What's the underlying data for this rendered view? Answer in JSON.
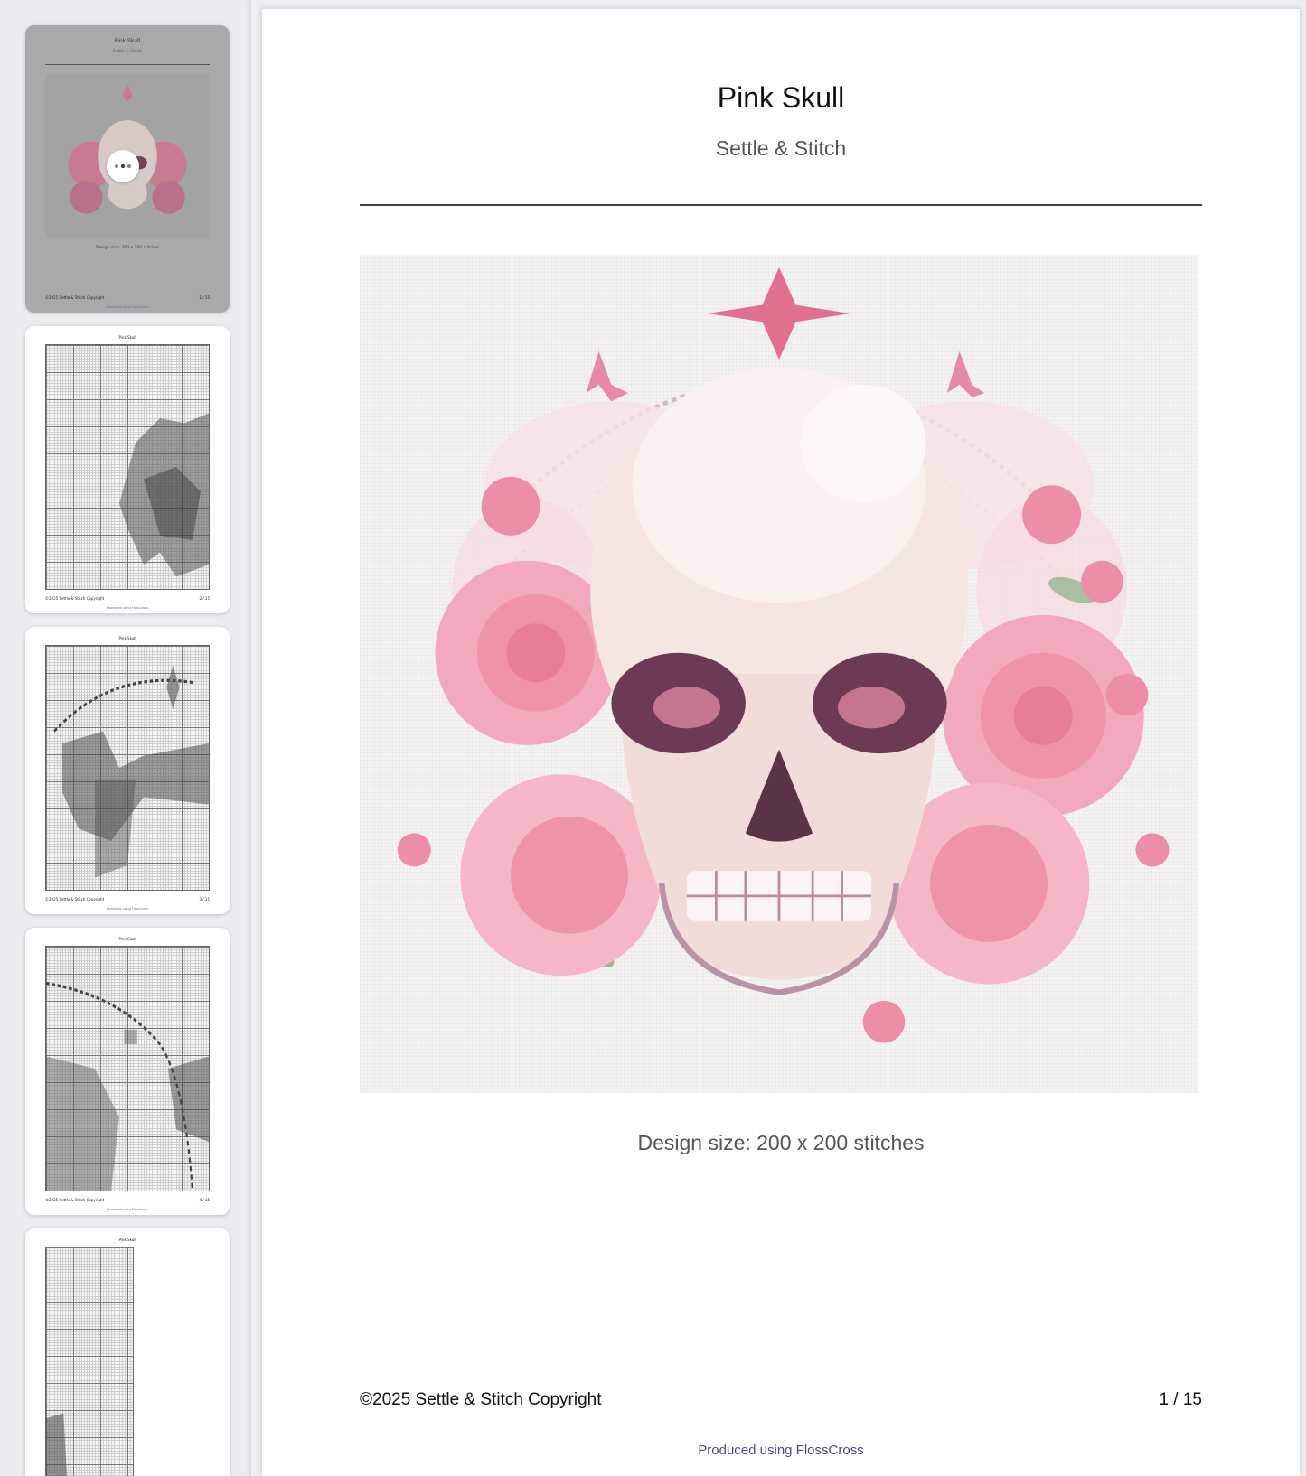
{
  "document": {
    "title": "Pink Skull",
    "subtitle": "Settle & Stitch",
    "design_size": "Design size: 200 x 200 stitches",
    "copyright": "©2025 Settle & Stitch Copyright",
    "page_indicator": "1 / 15",
    "produced_by": "Produced using FlossCross"
  },
  "thumbnails": [
    {
      "title": "Pink Skull",
      "subtitle": "Settle & Stitch",
      "size": "Design size: 200 x 200 stitches",
      "copyright": "©2025 Settle & Stitch Copyright",
      "page": "1 / 15",
      "produced": "Produced using FlossCross",
      "selected": true
    },
    {
      "title": "Pink Skull",
      "copyright": "©2025 Settle & Stitch Copyright",
      "page": "2 / 15",
      "produced": "Produced using FlossCross"
    },
    {
      "title": "Pink Skull",
      "copyright": "©2025 Settle & Stitch Copyright",
      "page": "3 / 15",
      "produced": "Produced using FlossCross"
    },
    {
      "title": "Pink Skull",
      "copyright": "©2025 Settle & Stitch Copyright",
      "page": "4 / 15",
      "produced": "Produced using FlossCross"
    },
    {
      "title": "Pink Skull"
    }
  ],
  "colors": {
    "accent_pink": "#e0708e",
    "rose_light": "#f3b7c6",
    "skull_bone": "#f6e6e2",
    "leaf_green": "#8fa888",
    "produced_link": "#4a4a8c"
  },
  "icons": {
    "more_options": "more-dots-icon"
  }
}
